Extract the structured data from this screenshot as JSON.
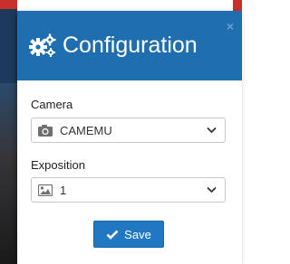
{
  "modal": {
    "title": "Configuration",
    "close_glyph": "×",
    "header_icon": "cogs-icon"
  },
  "camera": {
    "label": "Camera",
    "selected": "CAMEMU",
    "icon": "camera-icon"
  },
  "exposition": {
    "label": "Exposition",
    "selected": "1",
    "icon": "image-icon"
  },
  "save_button": {
    "label": "Save",
    "icon": "check-icon"
  },
  "colors": {
    "header": "#1f6fb0",
    "button": "#1f78c1",
    "text": "#1f1f1f"
  }
}
